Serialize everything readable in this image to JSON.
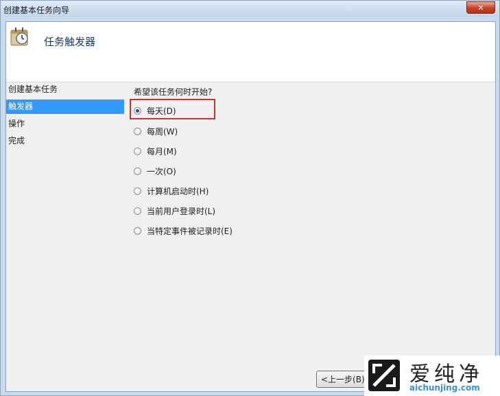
{
  "window": {
    "title": "创建基本任务向导",
    "close_label": "✕"
  },
  "header": {
    "title": "任务触发器",
    "icon": "clock-icon"
  },
  "nav": {
    "items": [
      {
        "label": "创建基本任务",
        "active": false
      },
      {
        "label": "触发器",
        "active": true
      },
      {
        "label": "操作",
        "active": false
      },
      {
        "label": "完成",
        "active": false
      }
    ]
  },
  "content": {
    "question": "希望该任务何时开始?",
    "options": [
      {
        "label": "每天(D)",
        "checked": true
      },
      {
        "label": "每周(W)",
        "checked": false
      },
      {
        "label": "每月(M)",
        "checked": false
      },
      {
        "label": "一次(O)",
        "checked": false
      },
      {
        "label": "计算机启动时(H)",
        "checked": false
      },
      {
        "label": "当前用户登录时(L)",
        "checked": false
      },
      {
        "label": "当特定事件被记录时(E)",
        "checked": false
      }
    ]
  },
  "buttons": {
    "back_label": "<上一步(B)"
  },
  "watermark": {
    "title": "爱纯净",
    "subtitle": "aichunjing.com",
    "highlight_color": "#e0292e"
  }
}
